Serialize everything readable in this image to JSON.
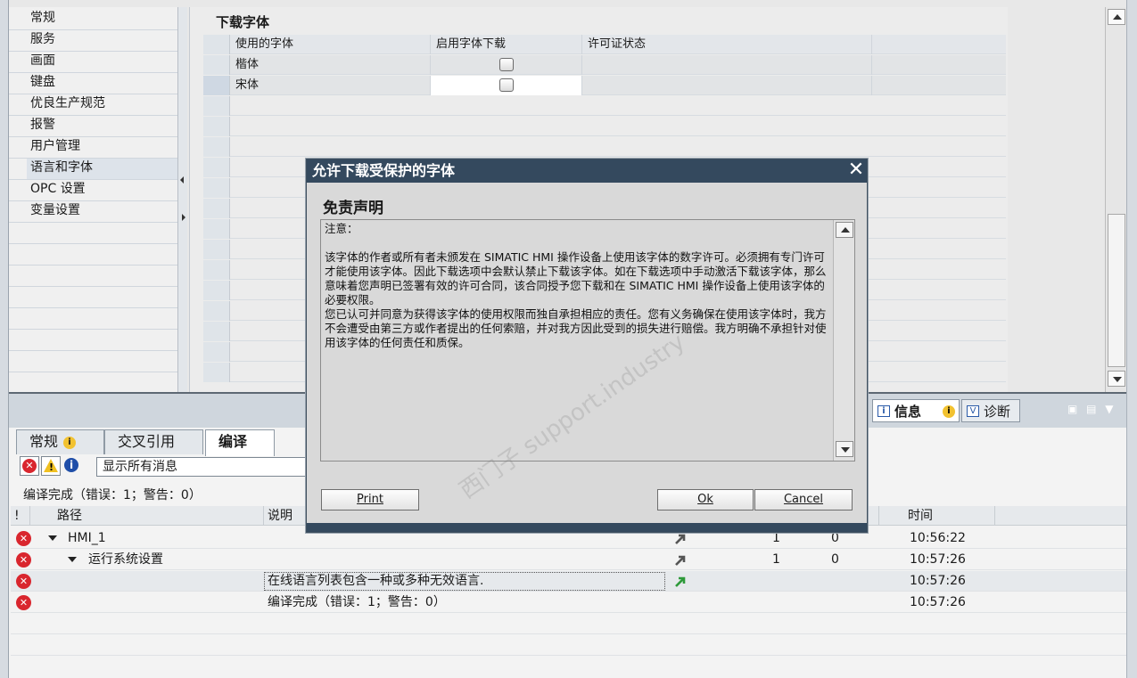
{
  "nav": {
    "items": [
      {
        "label": "常规"
      },
      {
        "label": "服务"
      },
      {
        "label": "画面"
      },
      {
        "label": "键盘"
      },
      {
        "label": "优良生产规范"
      },
      {
        "label": "报警"
      },
      {
        "label": "用户管理"
      },
      {
        "label": "语言和字体"
      },
      {
        "label": "OPC 设置"
      },
      {
        "label": "变量设置"
      }
    ],
    "selected": "语言和字体"
  },
  "section": {
    "title": "下载字体",
    "columns": [
      "使用的字体",
      "启用字体下载",
      "许可证状态"
    ],
    "rows": [
      {
        "font": "楷体",
        "enabled": false,
        "license": ""
      },
      {
        "font": "宋体",
        "enabled": false,
        "license": ""
      }
    ]
  },
  "inspector": {
    "info_tab": "信息",
    "diag_tab": "诊断",
    "tabs": [
      "常规",
      "交叉引用",
      "编译"
    ],
    "active_tab": "编译",
    "filter_value": "显示所有消息",
    "summary": "编译完成（错误：1；警告：0）",
    "columns": [
      "!",
      "路径",
      "说明",
      "时间"
    ],
    "messages": [
      {
        "path": "HMI_1",
        "desc": "",
        "errors": "1",
        "warnings": "0",
        "time": "10:56:22"
      },
      {
        "path": "运行系统设置",
        "desc": "",
        "errors": "1",
        "warnings": "0",
        "time": "10:57:26"
      },
      {
        "path": "",
        "desc": "在线语言列表包含一种或多种无效语言.",
        "errors": "",
        "warnings": "",
        "time": "10:57:26"
      },
      {
        "path": "",
        "desc": "编译完成（错误：1；警告：0）",
        "errors": "",
        "warnings": "",
        "time": "10:57:26"
      }
    ]
  },
  "dialog": {
    "title": "允许下载受保护的字体",
    "heading": "免责声明",
    "body": "注意：\n\n该字体的作者或所有者未颁发在 SIMATIC HMI 操作设备上使用该字体的数字许可。必须拥有专门许可才能使用该字体。因此下载选项中会默认禁止下载该字体。如在下载选项中手动激活下载该字体，那么意味着您声明已签署有效的许可合同，该合同授予您下载和在 SIMATIC HMI 操作设备上使用该字体的必要权限。\n您已认可并同意为获得该字体的使用权限而独自承担相应的责任。您有义务确保在使用该字体时，我方不会遭受由第三方或作者提出的任何索赔，并对我方因此受到的损失进行赔偿。我方明确不承担针对使用该字体的任何责任和质保。",
    "print_label": "Print",
    "ok_label": "Ok",
    "cancel_label": "Cancel",
    "watermark": "西门子 support.industry"
  },
  "colors": {
    "dialog_title_bg": "#34495e",
    "error_red": "#d9262e",
    "warning_yellow": "#f0c020",
    "info_blue": "#1f4ea8",
    "goto_arrow_green": "#2e9a3a"
  }
}
